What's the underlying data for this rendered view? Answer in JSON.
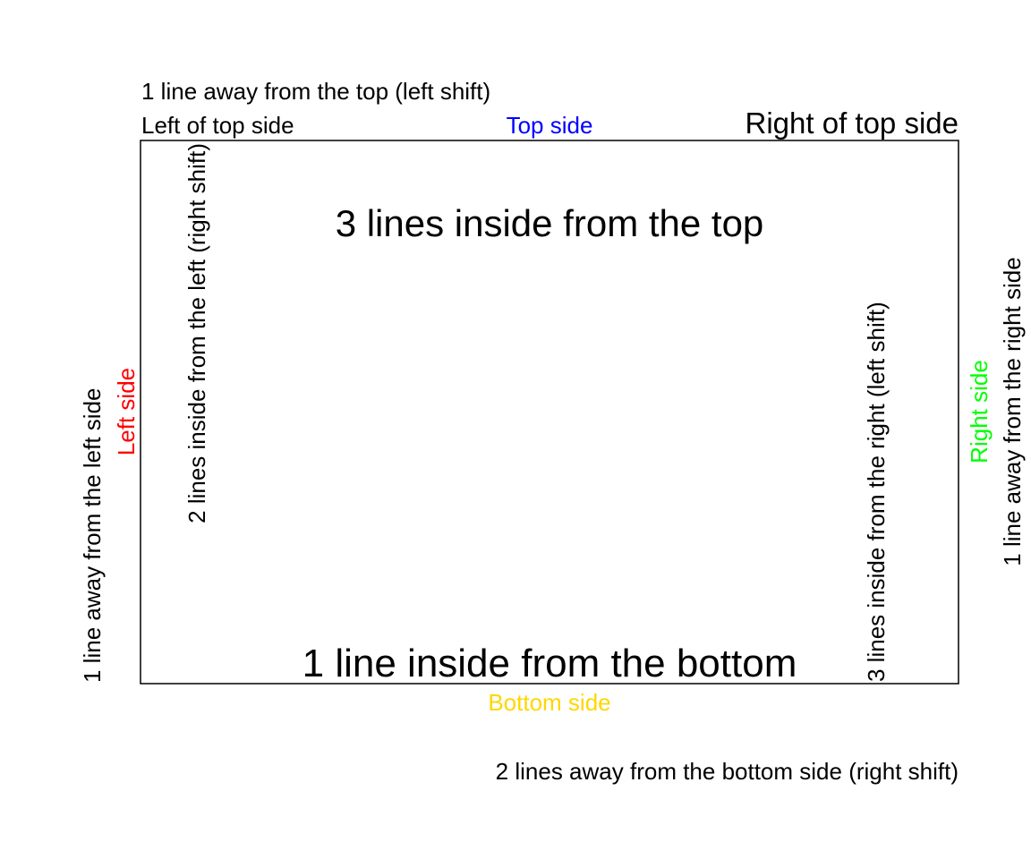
{
  "colors": {
    "top_side": "#0000FF",
    "left_side": "#FF0000",
    "right_side": "#00FF00",
    "bottom_side": "#FFD700",
    "default": "#000000"
  },
  "labels": {
    "top_outer_1": "1 line away from the top (left shift)",
    "left_of_top": "Left of top side",
    "top_side": "Top side",
    "right_of_top": "Right of top side",
    "top_inside_3": "3 lines inside from the top",
    "bottom_inside_1": "1 line inside from the bottom",
    "bottom_side": "Bottom side",
    "bottom_outer_2": "2 lines away from the bottom side (right shift)",
    "left_outer_1": "1 line away from the left side",
    "left_side": "Left side",
    "left_inside_2": "2 lines inside from the left (right shift)",
    "right_inside_3": "3 lines inside from the right (left shift)",
    "right_side": "Right side",
    "right_outer_1": "1 line away from the right side"
  }
}
